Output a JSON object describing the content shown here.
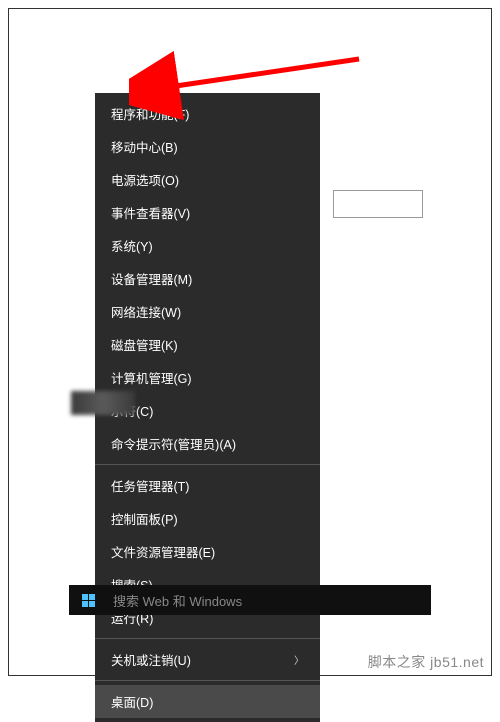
{
  "menu": {
    "items": [
      {
        "label": "程序和功能(F)",
        "submenu": false
      },
      {
        "label": "移动中心(B)",
        "submenu": false
      },
      {
        "label": "电源选项(O)",
        "submenu": false
      },
      {
        "label": "事件查看器(V)",
        "submenu": false
      },
      {
        "label": "系统(Y)",
        "submenu": false
      },
      {
        "label": "设备管理器(M)",
        "submenu": false
      },
      {
        "label": "网络连接(W)",
        "submenu": false
      },
      {
        "label": "磁盘管理(K)",
        "submenu": false
      },
      {
        "label": "计算机管理(G)",
        "submenu": false
      },
      {
        "label": "示符(C)",
        "submenu": false
      },
      {
        "label": "命令提示符(管理员)(A)",
        "submenu": false
      },
      {
        "label": "任务管理器(T)",
        "submenu": false
      },
      {
        "label": "控制面板(P)",
        "submenu": false
      },
      {
        "label": "文件资源管理器(E)",
        "submenu": false
      },
      {
        "label": "搜索(S)",
        "submenu": false
      },
      {
        "label": "运行(R)",
        "submenu": false
      },
      {
        "label": "关机或注销(U)",
        "submenu": true
      },
      {
        "label": "桌面(D)",
        "submenu": false,
        "highlighted": true
      }
    ],
    "separators_after": [
      10,
      15,
      16
    ]
  },
  "taskbar": {
    "search_placeholder": "搜索 Web 和 Windows"
  },
  "watermark": "脚本之家 jb51.net",
  "annotation": {
    "arrow_color": "#ff0000"
  }
}
